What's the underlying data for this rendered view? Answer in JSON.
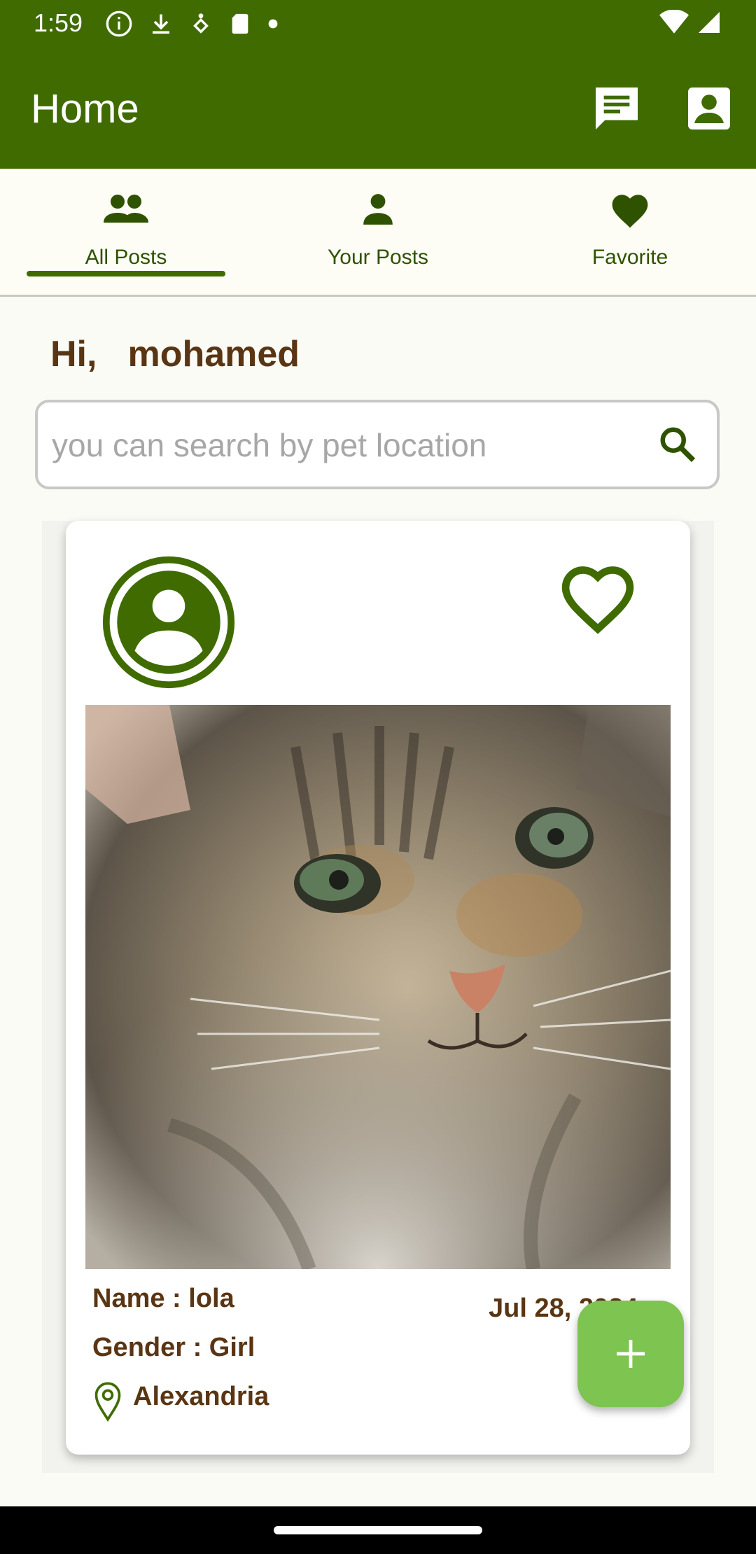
{
  "status_bar": {
    "time": "1:59"
  },
  "app_bar": {
    "title": "Home"
  },
  "tabs": [
    {
      "label": "All Posts",
      "icon": "group-icon",
      "selected": true
    },
    {
      "label": "Your Posts",
      "icon": "person-icon",
      "selected": false
    },
    {
      "label": "Favorite",
      "icon": "heart-icon",
      "selected": false
    }
  ],
  "greeting": {
    "hi": "Hi,",
    "name": "mohamed"
  },
  "search": {
    "placeholder": "you can search by pet location",
    "value": ""
  },
  "post": {
    "name_line": "Name   : lola",
    "gender_line": "Gender : Girl",
    "location": "Alexandria",
    "date": "Jul 28, 2024"
  },
  "colors": {
    "primary": "#3f6b00",
    "accent_text": "#5a3513",
    "fab": "#7dc450",
    "background": "#fbfbf5"
  }
}
